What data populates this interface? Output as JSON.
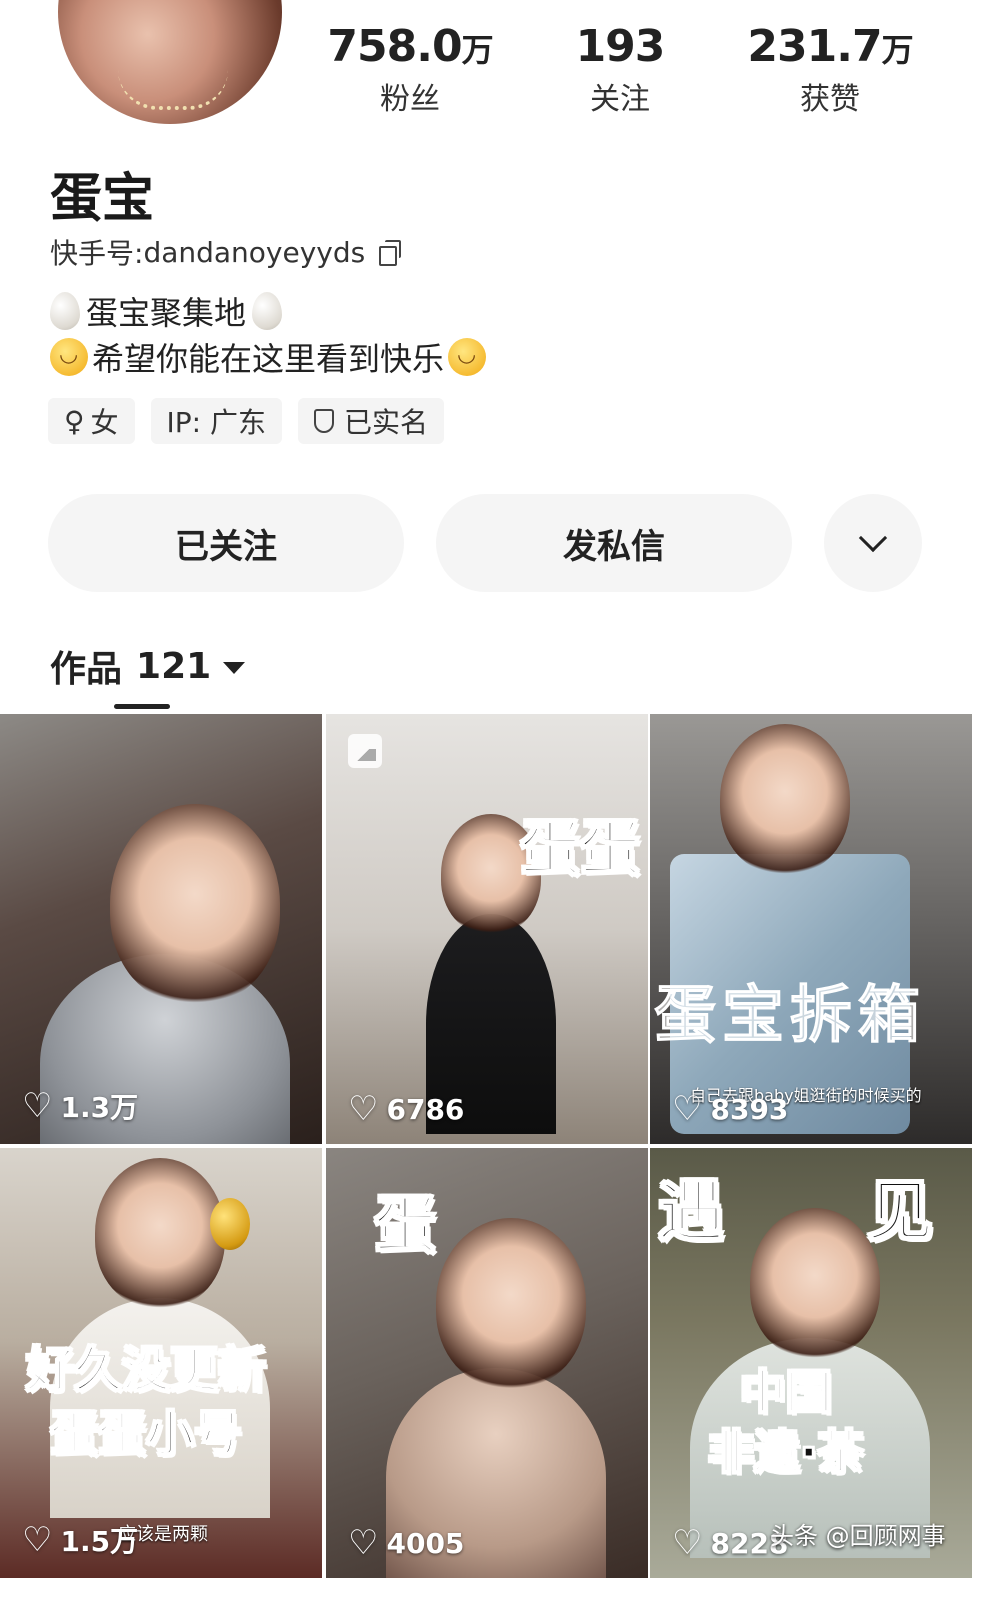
{
  "profile": {
    "name": "蛋宝",
    "kuaishou_id_label": "快手号:",
    "kuaishou_id": "dandanoyeyyds",
    "bio_line1": "蛋宝聚集地",
    "bio_line2": "希望你能在这里看到快乐"
  },
  "stats": [
    {
      "value": "758.0",
      "unit": "万",
      "label": "粉丝"
    },
    {
      "value": "193",
      "unit": "",
      "label": "关注"
    },
    {
      "value": "231.7",
      "unit": "万",
      "label": "获赞"
    }
  ],
  "tags": {
    "gender": "女",
    "gender_symbol": "♀",
    "ip": "IP:  广东",
    "verified": "已实名"
  },
  "actions": {
    "follow": "已关注",
    "message": "发私信"
  },
  "works": {
    "label": "作品",
    "count": "121"
  },
  "videos": [
    {
      "likes": "1.3万",
      "overlay": "",
      "subcaption": ""
    },
    {
      "likes": "6786",
      "overlay": "蛋蛋",
      "subcaption": ""
    },
    {
      "likes": "8393",
      "overlay": "蛋宝拆箱",
      "subcaption": "自己去跟baby姐逛街的时候买的"
    },
    {
      "likes": "1.5万",
      "overlay": "好久没更新\n蛋蛋小号",
      "subcaption": "应该是两颗"
    },
    {
      "likes": "4005",
      "overlay": "蛋",
      "subcaption": ""
    },
    {
      "likes": "8228",
      "overlay": "遇 见",
      "overlay2": "中国\n非遗·茶",
      "subcaption": ""
    }
  ],
  "watermark": "头条 @回顾网事"
}
